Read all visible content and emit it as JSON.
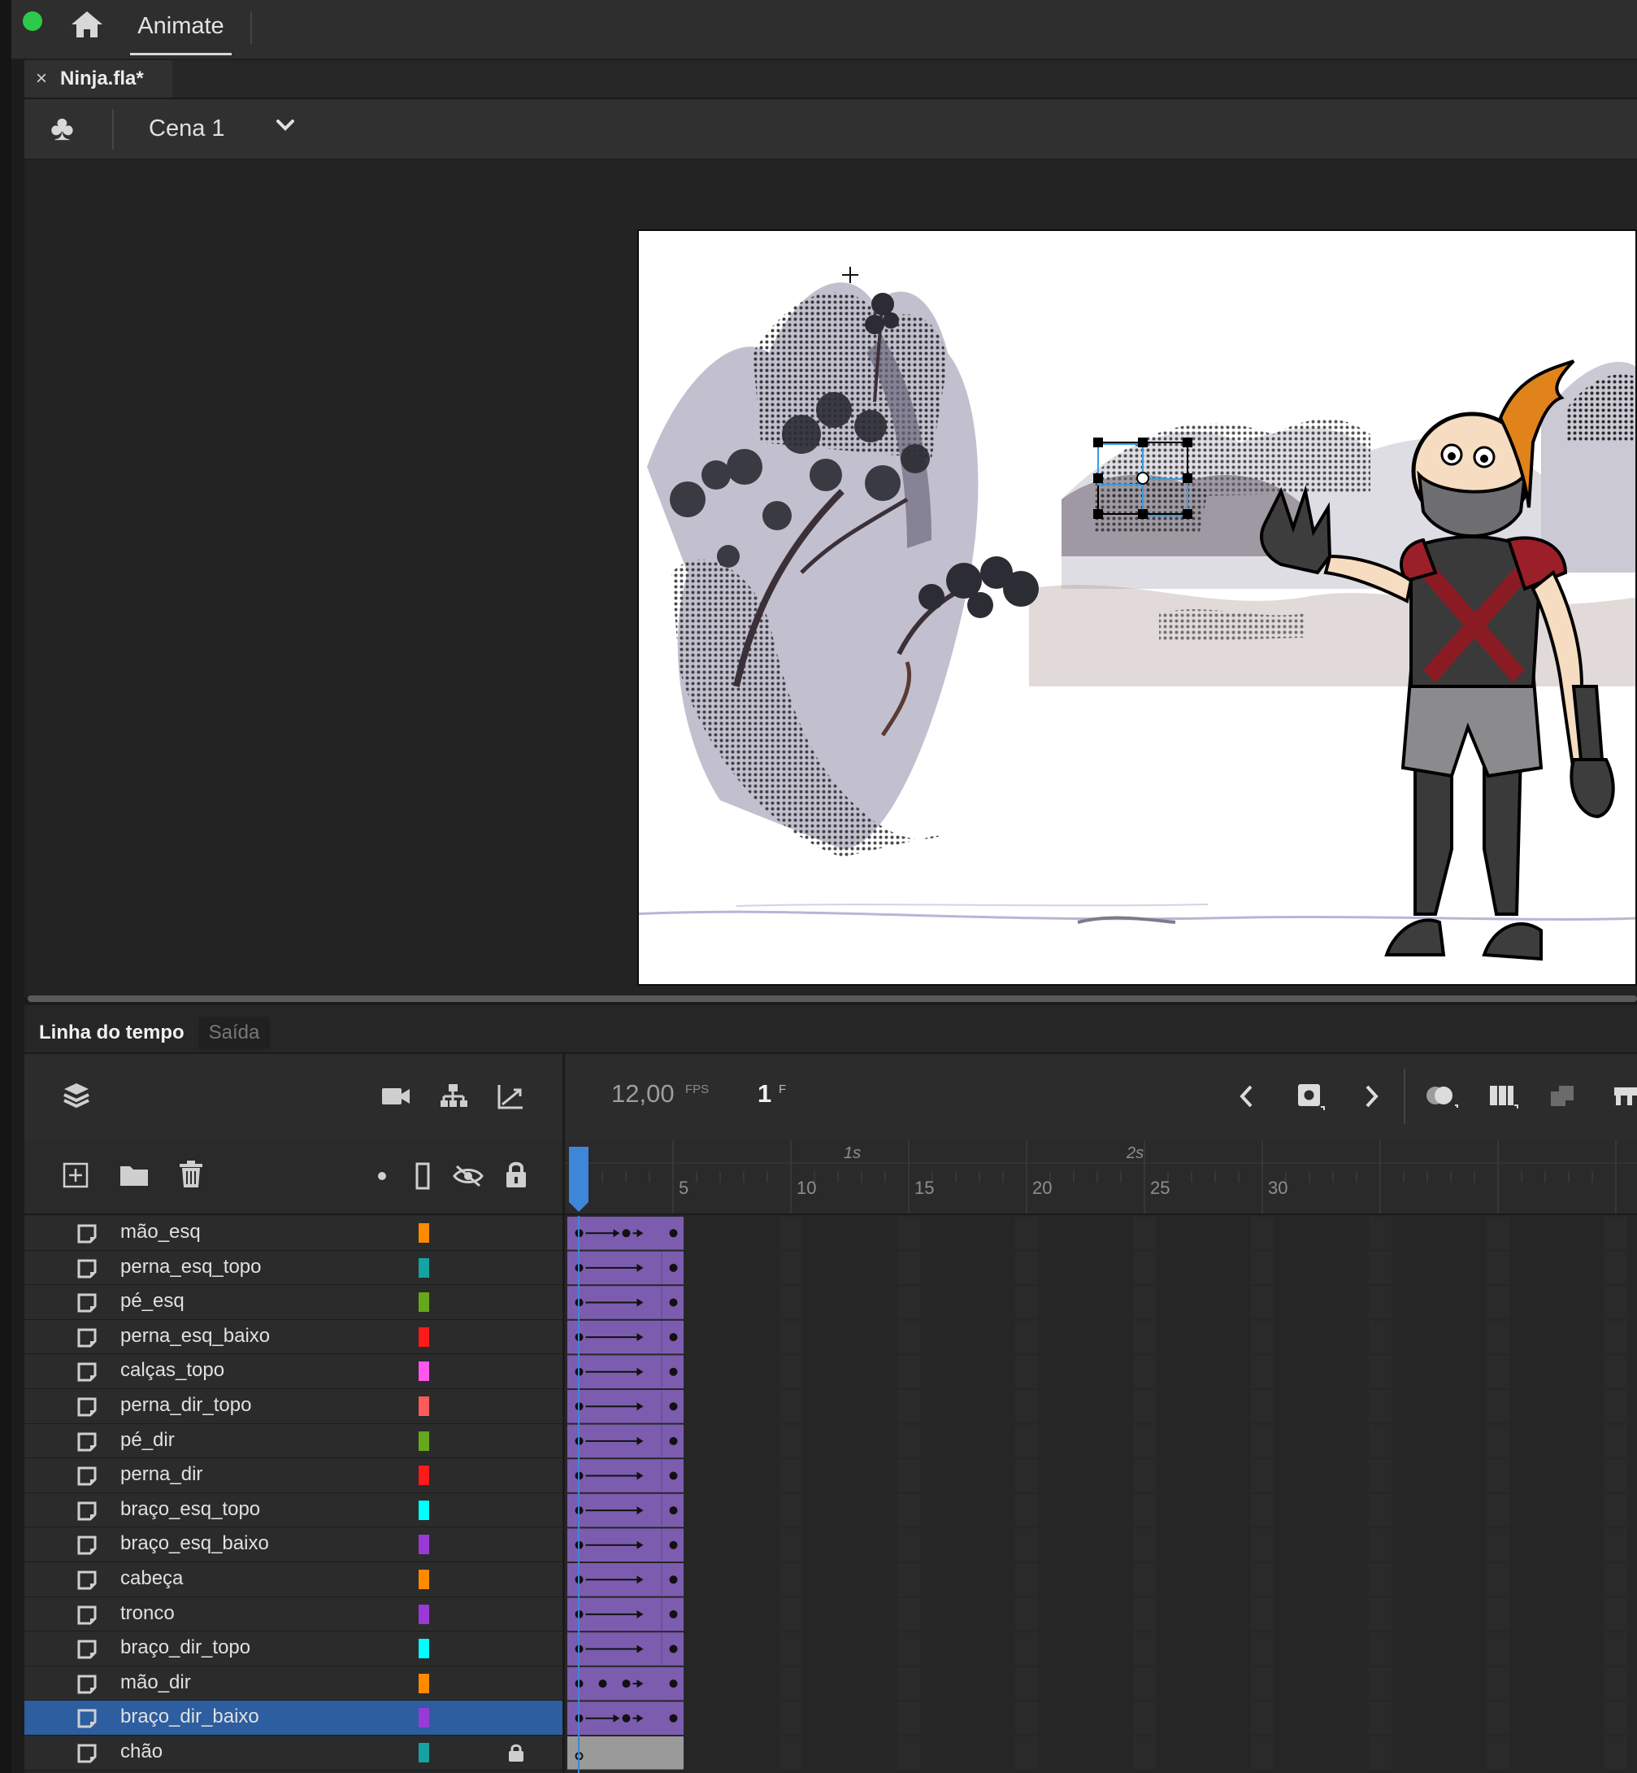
{
  "app": {
    "workspace_tab": "Animate",
    "document_tab": "Ninja.fla*",
    "document_close": "×"
  },
  "scene": {
    "name": "Cena 1"
  },
  "panel_tabs": {
    "timeline": "Linha do tempo",
    "output": "Saída"
  },
  "playback": {
    "fps_value": "12,00",
    "fps_unit": "FPS",
    "frame_value": "1",
    "frame_unit": "F"
  },
  "ruler": {
    "numbers": [
      "5",
      "10",
      "15",
      "20",
      "25",
      "30"
    ],
    "seconds": [
      "1s",
      "2s"
    ]
  },
  "colors": {
    "accent_blue": "#3e86d8",
    "tween_purple": "#7c5caf",
    "selected_row": "#2c5ea0"
  },
  "layers": [
    {
      "name": "mão_esq",
      "color": "#ff8a00",
      "selected": false,
      "locked": false,
      "frames": "mixed"
    },
    {
      "name": "perna_esq_topo",
      "color": "#13a3a3",
      "selected": false,
      "locked": false,
      "frames": "tween"
    },
    {
      "name": "pé_esq",
      "color": "#66a81b",
      "selected": false,
      "locked": false,
      "frames": "tween"
    },
    {
      "name": "perna_esq_baixo",
      "color": "#ff1a1a",
      "selected": false,
      "locked": false,
      "frames": "tween"
    },
    {
      "name": "calças_topo",
      "color": "#ff57ee",
      "selected": false,
      "locked": false,
      "frames": "tween"
    },
    {
      "name": "perna_dir_topo",
      "color": "#ff5a5a",
      "selected": false,
      "locked": false,
      "frames": "tween"
    },
    {
      "name": "pé_dir",
      "color": "#66a81b",
      "selected": false,
      "locked": false,
      "frames": "tween"
    },
    {
      "name": "perna_dir",
      "color": "#ff1a1a",
      "selected": false,
      "locked": false,
      "frames": "tween"
    },
    {
      "name": "braço_esq_topo",
      "color": "#00ffff",
      "selected": false,
      "locked": false,
      "frames": "tween"
    },
    {
      "name": "braço_esq_baixo",
      "color": "#9a3ad6",
      "selected": false,
      "locked": false,
      "frames": "tween"
    },
    {
      "name": "cabeça",
      "color": "#ff8a00",
      "selected": false,
      "locked": false,
      "frames": "tween"
    },
    {
      "name": "tronco",
      "color": "#9a3ad6",
      "selected": false,
      "locked": false,
      "frames": "tween"
    },
    {
      "name": "braço_dir_topo",
      "color": "#00ffff",
      "selected": false,
      "locked": false,
      "frames": "tween"
    },
    {
      "name": "mão_dir",
      "color": "#ff8a00",
      "selected": false,
      "locked": false,
      "frames": "keys"
    },
    {
      "name": "braço_dir_baixo",
      "color": "#9a3ad6",
      "selected": true,
      "locked": false,
      "frames": "mixed"
    },
    {
      "name": "chão",
      "color": "#13a3a3",
      "selected": false,
      "locked": true,
      "frames": "static"
    }
  ]
}
